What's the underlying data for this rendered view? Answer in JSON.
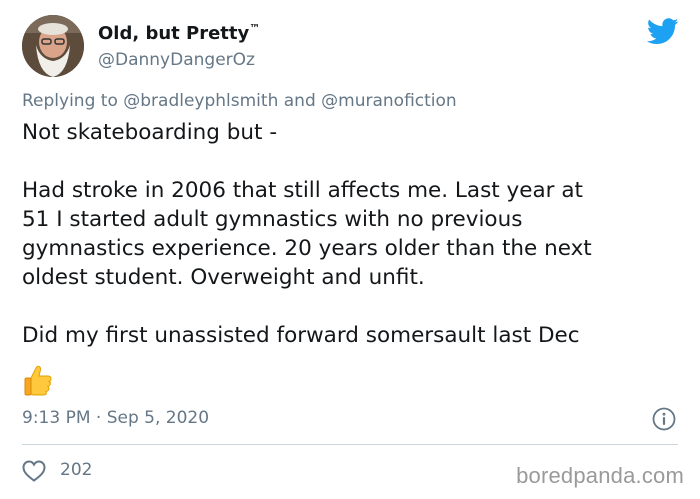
{
  "author": {
    "display_name": "Old, but Pretty",
    "name_mark": "™",
    "handle": "@DannyDangerOz"
  },
  "reply": {
    "prefix": "Replying to",
    "mention_1": "@bradleyphlsmith",
    "conjunction": "and",
    "mention_2": "@muranofiction"
  },
  "tweet": {
    "line_1": "Not skateboarding but -",
    "line_2": "Had stroke in 2006 that still affects me. Last year at",
    "line_3": "51 I started adult gymnastics with no previous",
    "line_4": "gymnastics experience. 20 years older than the next",
    "line_5": "oldest student. Overweight and unfit.",
    "line_6": "Did my first unassisted forward somersault last Dec",
    "emoji": "thumbs-up"
  },
  "meta": {
    "time": "9:13 PM",
    "separator": "·",
    "date": "Sep 5, 2020"
  },
  "stats": {
    "likes": "202"
  },
  "watermark": "boredpanda.com",
  "colors": {
    "twitter_blue": "#1da1f2",
    "secondary_text": "#657786",
    "primary_text": "#14171a"
  },
  "icons": {
    "brand": "twitter-bird-icon",
    "info": "info-icon",
    "like": "heart-icon"
  }
}
